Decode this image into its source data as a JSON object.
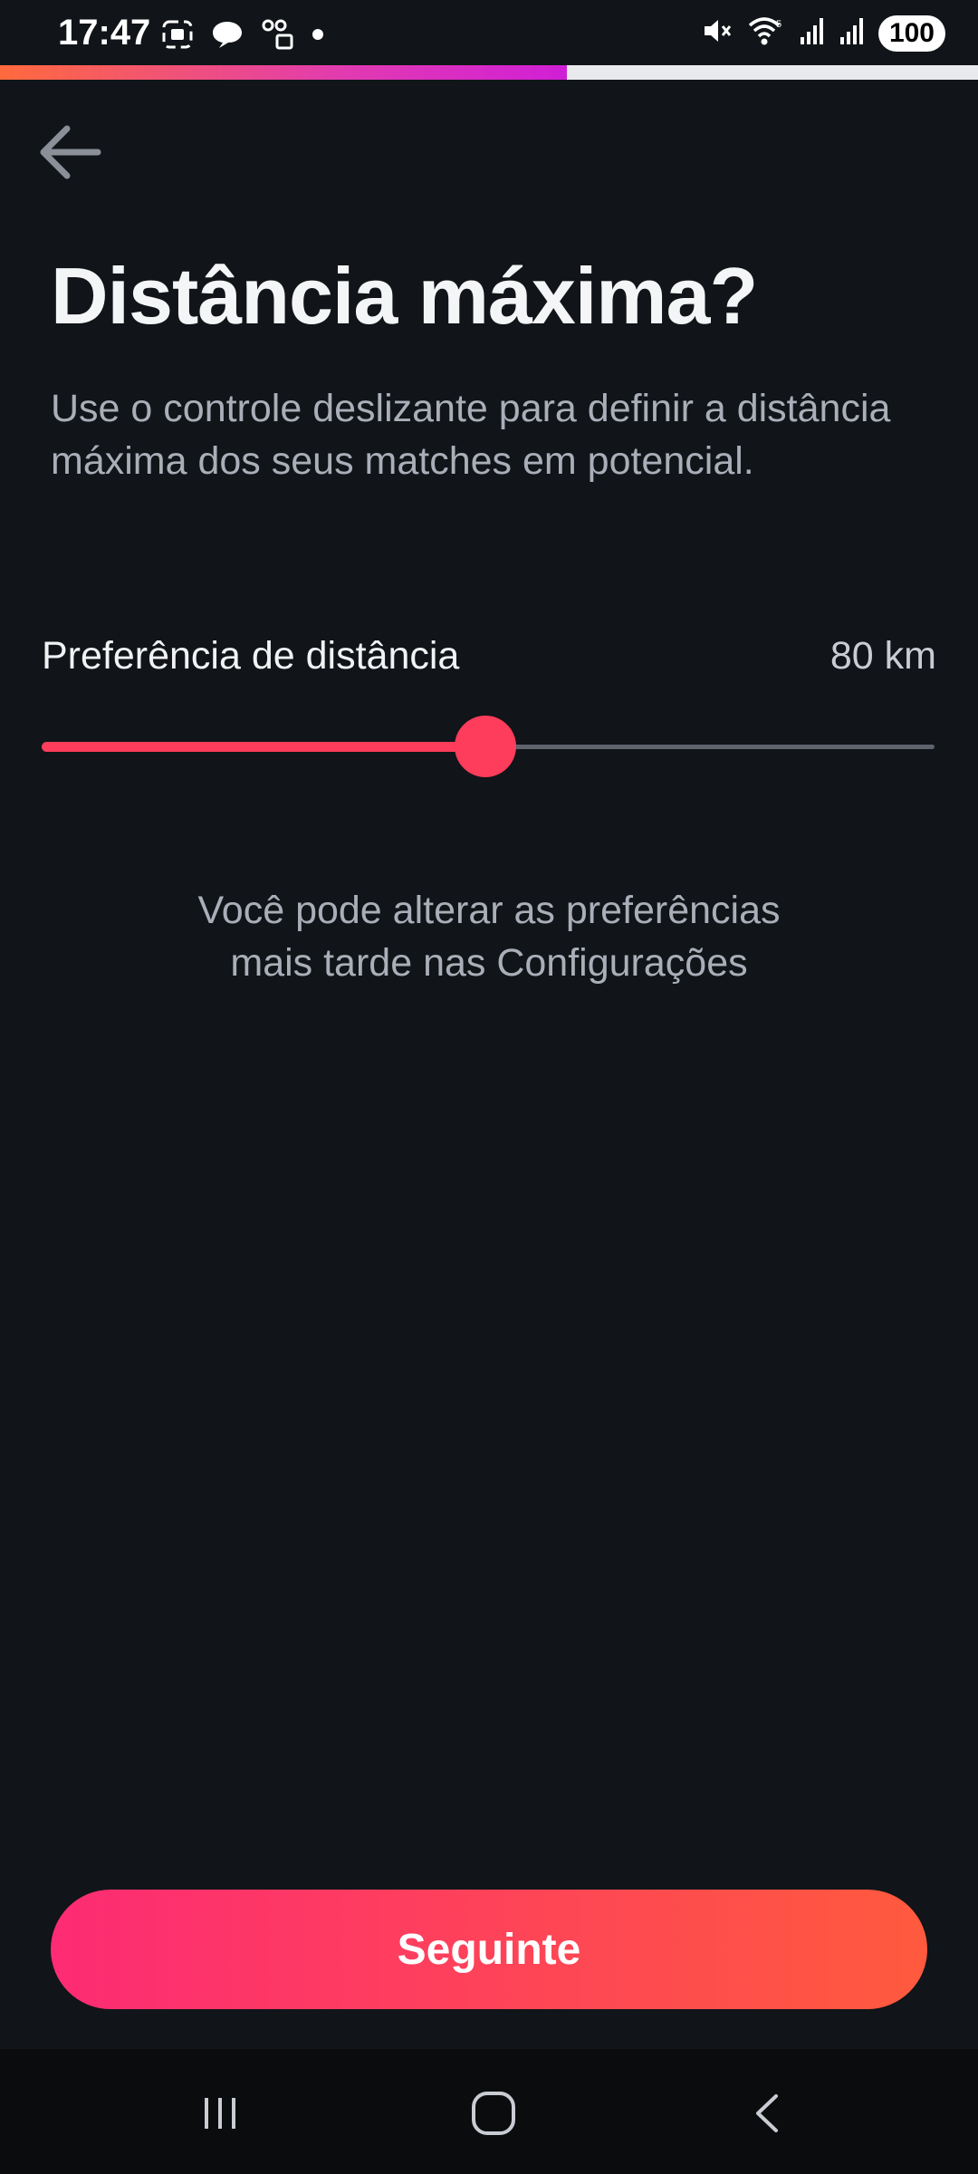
{
  "status_bar": {
    "time": "17:47",
    "battery": "100",
    "left_icons": [
      "screenshot-icon",
      "chat-bubble-icon",
      "voicemail-lock-icon",
      "dot-icon"
    ],
    "right_icons": [
      "mute-icon",
      "wifi-icon",
      "signal-icon",
      "signal-icon"
    ]
  },
  "progress": {
    "value": 0.58,
    "colors": [
      "#ff6a3d",
      "#e23bb0",
      "#d01fd6"
    ]
  },
  "header": {
    "back_icon": "arrow-left-icon"
  },
  "main": {
    "title": "Distância máxima?",
    "description": "Use o controle deslizante para definir a distância máxima dos seus matches em potencial.",
    "preference_label": "Preferência de distância",
    "preference_value": "80 km",
    "slider": {
      "fraction": 0.497,
      "color": "#fe3c5b"
    },
    "note_line1": "Você pode alterar as preferências",
    "note_line2": "mais tarde nas Configurações"
  },
  "footer": {
    "next_label": "Seguinte"
  },
  "navbar": {
    "icons": [
      "recents-icon",
      "home-icon",
      "back-icon"
    ]
  }
}
